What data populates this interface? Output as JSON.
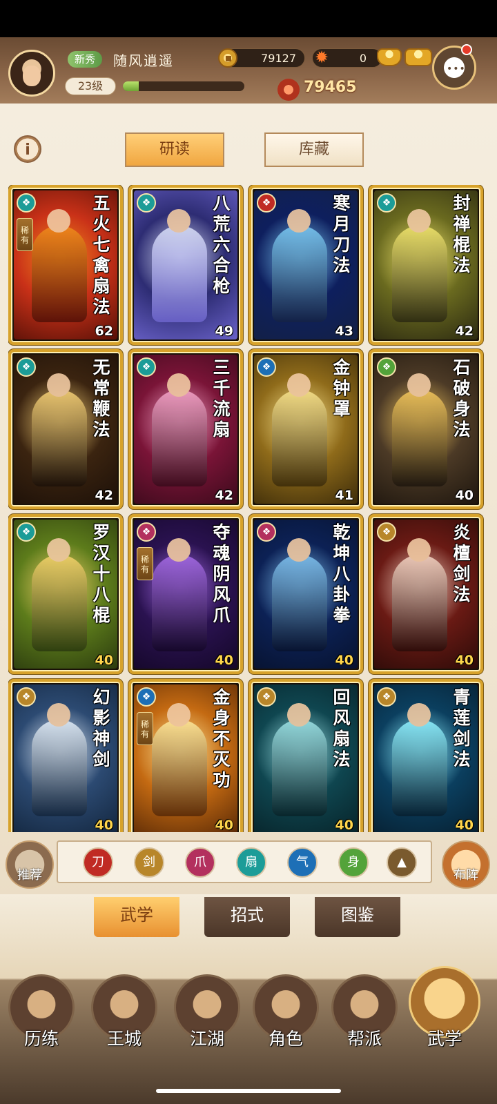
{
  "header": {
    "rank_badge": "新秀",
    "nickname": "随风逍遥",
    "level": "23级",
    "xp_fraction": 0.13,
    "coins": "79127",
    "gems": "0",
    "power": "79465"
  },
  "top_tabs": {
    "study": "研读",
    "library": "库藏",
    "info": "i"
  },
  "cards": [
    {
      "title": "五火七禽扇法",
      "level": "62",
      "rare": "稀有",
      "badge_icon": "fan-icon",
      "badge_color": "#1c9c98",
      "art": [
        "#c93118",
        "#f28b1d",
        "#561007"
      ],
      "level_gold": false
    },
    {
      "title": "八荒六合枪",
      "level": "49",
      "rare": "",
      "badge_icon": "fan-icon",
      "badge_color": "#1c9c98",
      "art": [
        "#2d2c73",
        "#d7ddf5",
        "#6a62c9"
      ],
      "level_gold": false
    },
    {
      "title": "寒月刀法",
      "level": "43",
      "rare": "",
      "badge_icon": "blade-icon",
      "badge_color": "#c02b24",
      "art": [
        "#0e1f5e",
        "#7bc8f2",
        "#132145"
      ],
      "level_gold": false
    },
    {
      "title": "封禅棍法",
      "level": "42",
      "rare": "",
      "badge_icon": "fan-icon",
      "badge_color": "#1c9c98",
      "art": [
        "#6a6a1f",
        "#f1e56e",
        "#2c2a11"
      ],
      "level_gold": false
    },
    {
      "title": "无常鞭法",
      "level": "42",
      "rare": "",
      "badge_icon": "fan-icon",
      "badge_color": "#1c9c98",
      "art": [
        "#3b2410",
        "#f4cf76",
        "#1c1008"
      ],
      "level_gold": false
    },
    {
      "title": "三千流扇",
      "level": "42",
      "rare": "",
      "badge_icon": "fan-icon",
      "badge_color": "#1c9c98",
      "art": [
        "#7a1437",
        "#f3a3c7",
        "#3b0a1b"
      ],
      "level_gold": false
    },
    {
      "title": "金钟罩",
      "level": "41",
      "rare": "",
      "badge_icon": "swirl-icon",
      "badge_color": "#1d6fb6",
      "art": [
        "#8f6b1a",
        "#f8e28c",
        "#3d2c09"
      ],
      "level_gold": false
    },
    {
      "title": "石破身法",
      "level": "40",
      "rare": "",
      "badge_icon": "leaf-icon",
      "badge_color": "#53a33a",
      "art": [
        "#4c3a26",
        "#f2c65d",
        "#1e160e"
      ],
      "level_gold": false
    },
    {
      "title": "罗汉十八棍",
      "level": "40",
      "rare": "",
      "badge_icon": "fan-icon",
      "badge_color": "#1c9c98",
      "art": [
        "#5d7c1b",
        "#f4d36b",
        "#2b3b0e"
      ],
      "level_gold": true
    },
    {
      "title": "夺魂阴风爪",
      "level": "40",
      "rare": "稀有",
      "badge_icon": "claw-icon",
      "badge_color": "#b3305e",
      "art": [
        "#2a1250",
        "#a56be6",
        "#140728"
      ],
      "level_gold": true
    },
    {
      "title": "乾坤八卦拳",
      "level": "40",
      "rare": "",
      "badge_icon": "claw-icon",
      "badge_color": "#b3305e",
      "art": [
        "#0c2155",
        "#7fc1ef",
        "#07122e"
      ],
      "level_gold": true
    },
    {
      "title": "炎檀剑法",
      "level": "40",
      "rare": "",
      "badge_icon": "sword-icon",
      "badge_color": "#b8862a",
      "art": [
        "#6a1a14",
        "#f4d3c2",
        "#2c0b08"
      ],
      "level_gold": true
    },
    {
      "title": "幻影神剑",
      "level": "40",
      "rare": "",
      "badge_icon": "sword-icon",
      "badge_color": "#b8862a",
      "art": [
        "#2c4a72",
        "#e1ecf7",
        "#13263e"
      ],
      "level_gold": true
    },
    {
      "title": "金身不灭功",
      "level": "40",
      "rare": "稀有",
      "badge_icon": "swirl-icon",
      "badge_color": "#1d6fb6",
      "art": [
        "#c46a12",
        "#ffe89a",
        "#5a2a06"
      ],
      "level_gold": true
    },
    {
      "title": "回风扇法",
      "level": "40",
      "rare": "",
      "badge_icon": "sword-icon",
      "badge_color": "#b8862a",
      "art": [
        "#0f4650",
        "#9ce1e4",
        "#072329"
      ],
      "level_gold": true
    },
    {
      "title": "青莲剑法",
      "level": "40",
      "rare": "",
      "badge_icon": "sword-icon",
      "badge_color": "#b8862a",
      "art": [
        "#0b3f5f",
        "#8ff1ff",
        "#061f30"
      ],
      "level_gold": true
    }
  ],
  "filter": {
    "recommend": "推荐",
    "formation": "布阵",
    "schools": [
      {
        "icon": "blade-icon",
        "color": "#c02b24",
        "glyph": "刀"
      },
      {
        "icon": "sword-icon",
        "color": "#b8862a",
        "glyph": "剑"
      },
      {
        "icon": "claw-icon",
        "color": "#b3305e",
        "glyph": "爪"
      },
      {
        "icon": "fan-icon",
        "color": "#1c9c98",
        "glyph": "扇"
      },
      {
        "icon": "swirl-icon",
        "color": "#1d6fb6",
        "glyph": "气"
      },
      {
        "icon": "leaf-icon",
        "color": "#53a33a",
        "glyph": "身"
      },
      {
        "icon": "up-arrow-icon",
        "color": "#7a5a2e",
        "glyph": "▲"
      }
    ]
  },
  "sub_tabs": [
    "武学",
    "招式",
    "图鉴"
  ],
  "nav": [
    {
      "label": "历练",
      "icon": "scroll-quest-icon"
    },
    {
      "label": "王城",
      "icon": "palace-icon"
    },
    {
      "label": "江湖",
      "icon": "jianghu-icon"
    },
    {
      "label": "角色",
      "icon": "character-icon"
    },
    {
      "label": "帮派",
      "icon": "guild-icon"
    },
    {
      "label": "武学",
      "icon": "martial-arts-icon"
    }
  ]
}
